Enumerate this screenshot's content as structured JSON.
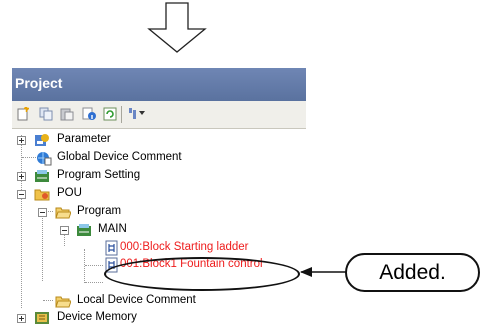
{
  "panel": {
    "title": "Project",
    "toolbar_icons": [
      "new-data-icon",
      "copy-icon",
      "paste-icon",
      "property-icon",
      "refresh-icon",
      "sort-icon"
    ]
  },
  "tree": {
    "parameter": "Parameter",
    "global_device_comment": "Global Device Comment",
    "program_setting": "Program Setting",
    "pou": "POU",
    "program": "Program",
    "main": "MAIN",
    "block_000": "000:Block Starting ladder",
    "block_001": "001:Block1 Fountain control",
    "local_device_comment": "Local Device Comment",
    "device_memory": "Device Memory"
  },
  "callout": {
    "text": "Added."
  },
  "colors": {
    "titlebar": "#5f77a6",
    "new_item_text": "#ee1c1c"
  }
}
